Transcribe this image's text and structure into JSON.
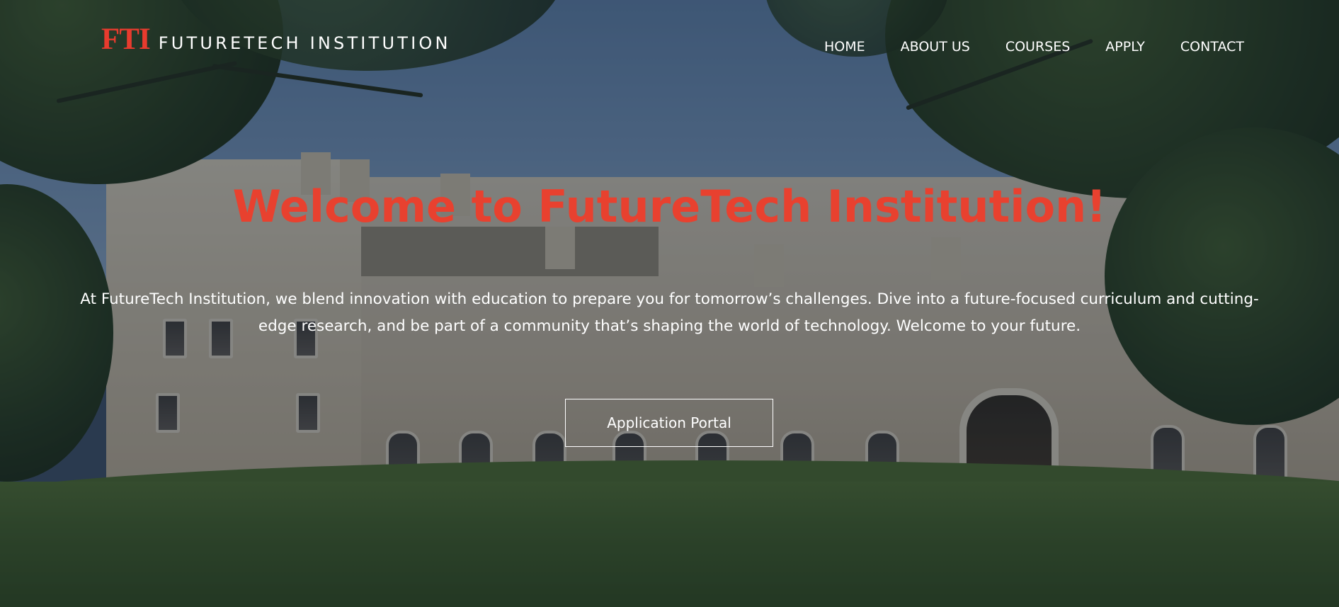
{
  "header": {
    "logo_mark": "FTI",
    "logo_text": "FUTURETECH INSTITUTION",
    "nav": [
      {
        "label": "HOME"
      },
      {
        "label": "ABOUT US"
      },
      {
        "label": "COURSES"
      },
      {
        "label": "APPLY"
      },
      {
        "label": "CONTACT"
      }
    ]
  },
  "hero": {
    "title": "Welcome to FutureTech Institution!",
    "description": "At FutureTech Institution, we blend innovation with education to prepare you for tomorrow’s challenges. Dive into a future-focused curriculum and cutting-edge research, and be part of a community that’s shaping the world of technology. Welcome to your future.",
    "cta_label": "Application Portal"
  },
  "colors": {
    "accent": "#e8412f",
    "text": "#ffffff"
  }
}
